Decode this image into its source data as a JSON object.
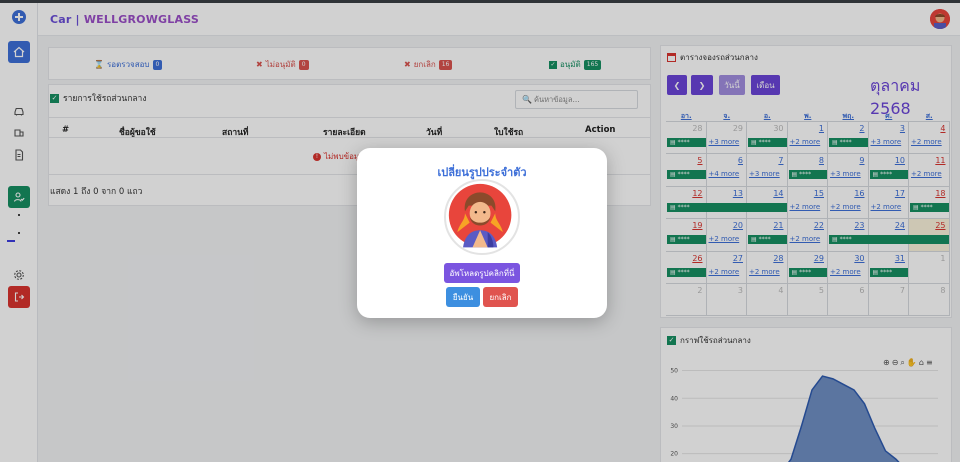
{
  "app": {
    "brand_prefix": "Car | ",
    "brand_name": "WELLGROWGLASS"
  },
  "colors": {
    "primary": "#3d6fd8",
    "purple": "#7b55e0",
    "green": "#168f62",
    "red": "#d9534f",
    "danger_sidebar": "#d9342f"
  },
  "stats": [
    {
      "label": "รอตรวจสอบ",
      "count": "0",
      "icon": "hourglass-icon",
      "color": "#3d6fd8"
    },
    {
      "label": "ไม่อนุมัติ",
      "count": "0",
      "icon": "x-icon",
      "color": "#d9534f"
    },
    {
      "label": "ยกเลิก",
      "count": "16",
      "icon": "x-icon",
      "color": "#d9534f"
    },
    {
      "label": "อนุมัติ",
      "count": "165",
      "icon": "check-icon",
      "color": "#168f62"
    }
  ],
  "list": {
    "title": "รายการใช้รถส่วนกลาง",
    "search_placeholder": "ค้นหาข้อมูล...",
    "columns": [
      "#",
      "ชื่อผู้ขอใช้",
      "สถานที่",
      "รายละเอียด",
      "วันที่",
      "ใบใช้รถ",
      "Action"
    ],
    "empty_text": "ไม่พบข้อมูล",
    "footer": "แสดง 1 ถึง 0 จาก 0 แถว"
  },
  "calendar": {
    "title": "ตารางจองรถส่วนกลาง",
    "today_label": "วันนี้",
    "month_label": "เดือน",
    "month_title": "ตุลาคม 2568",
    "days": [
      "อา.",
      "จ.",
      "อ.",
      "พ.",
      "พฤ.",
      "ศ.",
      "ส."
    ],
    "weeks": [
      [
        "28",
        "29",
        "30",
        "1",
        "2",
        "3",
        "4"
      ],
      [
        "5",
        "6",
        "7",
        "8",
        "9",
        "10",
        "11"
      ],
      [
        "12",
        "13",
        "14",
        "15",
        "16",
        "17",
        "18"
      ],
      [
        "19",
        "20",
        "21",
        "22",
        "23",
        "24",
        "25"
      ],
      [
        "26",
        "27",
        "28",
        "29",
        "30",
        "31",
        "1"
      ],
      [
        "2",
        "3",
        "4",
        "5",
        "6",
        "7",
        "8"
      ]
    ],
    "event_label": "****",
    "more_links": {
      "w0": [
        "+3 more",
        "+2 more",
        "+3 more",
        "+2 more"
      ],
      "w1": [
        "+4 more",
        "+3 more",
        "+3 more",
        "+2 more"
      ],
      "w2": [
        "+2 more",
        "+2 more",
        "+2 more"
      ],
      "w3": [
        "+2 more",
        "+2 more"
      ],
      "w4": [
        "+2 more",
        "+2 more",
        "+2 more"
      ]
    }
  },
  "chart": {
    "title": "กราฟใช้รถส่วนกลาง",
    "toolbar_icons": [
      "zoom-in-icon",
      "zoom-out-icon",
      "magnify-icon",
      "pan-icon",
      "home-icon",
      "menu-icon"
    ]
  },
  "chart_data": {
    "type": "area",
    "y_ticks": [
      "50",
      "40",
      "30",
      "20"
    ],
    "ylim": [
      17,
      52
    ],
    "x": [
      0,
      1,
      2,
      3,
      4,
      5,
      6,
      7,
      8,
      9,
      10,
      11,
      12,
      13,
      14
    ],
    "values": [
      10,
      13,
      18,
      30,
      43,
      48,
      47,
      45,
      43,
      38,
      29,
      21,
      18,
      14,
      10
    ]
  },
  "modal": {
    "title": "เปลี่ยนรูปประจำตัว",
    "upload_label": "อัพโหลดรูปคลิกที่นี่",
    "confirm_label": "ยืนยัน",
    "cancel_label": "ยกเลิก"
  }
}
